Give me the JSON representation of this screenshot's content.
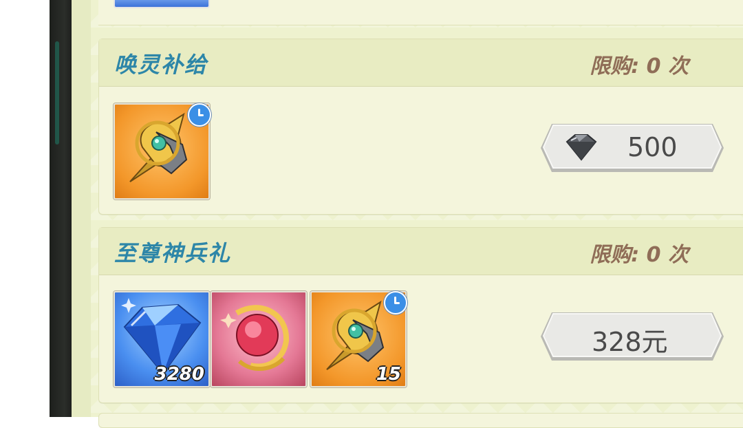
{
  "shop": {
    "cards": [
      {
        "title": "唤灵补给",
        "limit": "限购: 0 次",
        "items": [
          {
            "icon": "golden-amulet-icon",
            "quantity": "",
            "has_timer": true
          }
        ],
        "price": {
          "currency_icon": "diamond-icon",
          "value": "500"
        }
      },
      {
        "title": "至尊神兵礼",
        "limit": "限购: 0 次",
        "items": [
          {
            "icon": "blue-diamond-icon",
            "quantity": "3280",
            "has_timer": false
          },
          {
            "icon": "crimson-orb-icon",
            "quantity": "",
            "has_timer": false
          },
          {
            "icon": "golden-amulet-icon",
            "quantity": "15",
            "has_timer": true
          }
        ],
        "price": {
          "value": "328元"
        }
      }
    ]
  }
}
